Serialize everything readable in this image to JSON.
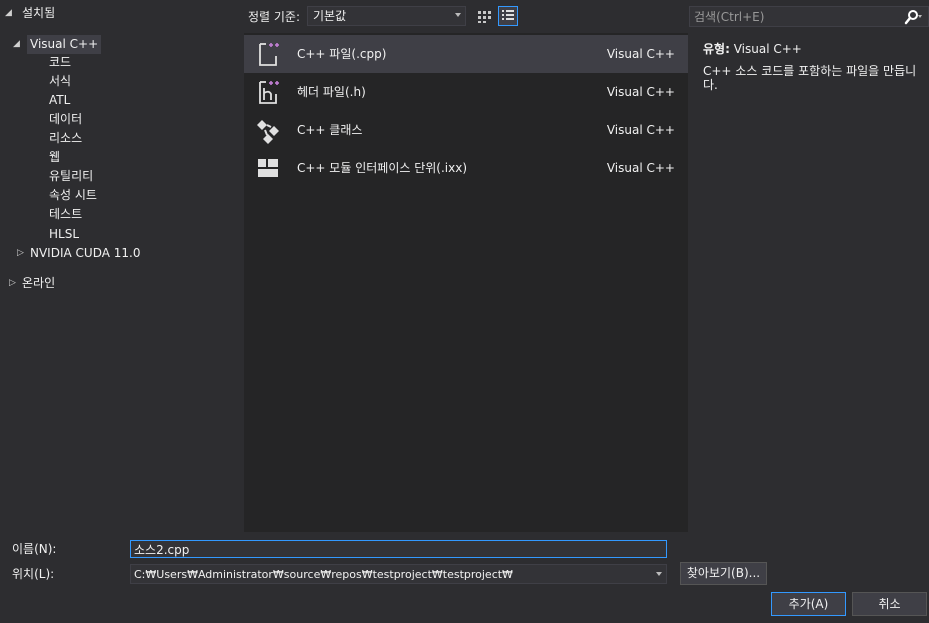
{
  "tree": {
    "items": [
      {
        "label": "설치됨",
        "state": "expanded"
      },
      {
        "label": "Visual C++",
        "state": "expanded"
      },
      {
        "label": "코드"
      },
      {
        "label": "서식"
      },
      {
        "label": "ATL"
      },
      {
        "label": "데이터"
      },
      {
        "label": "리소스"
      },
      {
        "label": "웹"
      },
      {
        "label": "유틸리티"
      },
      {
        "label": "속성 시트"
      },
      {
        "label": "테스트"
      },
      {
        "label": "HLSL"
      },
      {
        "label": "NVIDIA CUDA 11.0",
        "state": "collapsed"
      },
      {
        "label": "온라인",
        "state": "collapsed"
      }
    ]
  },
  "toolbar": {
    "sort_label": "정렬 기준:",
    "sort_value": "기본값",
    "search_placeholder": "검색(Ctrl+E)"
  },
  "templates": [
    {
      "name": "C++ 파일(.cpp)",
      "lang": "Visual C++",
      "icon": "cpp-file-icon",
      "selected": true
    },
    {
      "name": "헤더 파일(.h)",
      "lang": "Visual C++",
      "icon": "header-file-icon"
    },
    {
      "name": "C++ 클래스",
      "lang": "Visual C++",
      "icon": "class-icon"
    },
    {
      "name": "C++ 모듈 인터페이스 단위(.ixx)",
      "lang": "Visual C++",
      "icon": "module-icon"
    }
  ],
  "details": {
    "type_key": "유형:",
    "type_value": "Visual C++",
    "description": "C++ 소스 코드를 포함하는 파일을 만듭니다."
  },
  "form": {
    "name_label": "이름(N):",
    "name_value": "소스2.cpp",
    "location_label": "위치(L):",
    "location_value": "C:₩Users₩Administrator₩source₩repos₩testproject₩testproject₩",
    "browse_label": "찾아보기(B)...",
    "add_label": "추가(A)",
    "cancel_label": "취소"
  },
  "colors": {
    "background": "#2d2d30",
    "list_background": "#252526",
    "selection": "#3f3f46",
    "accent": "#3399ff",
    "icon_accent": "#c27fd4"
  }
}
